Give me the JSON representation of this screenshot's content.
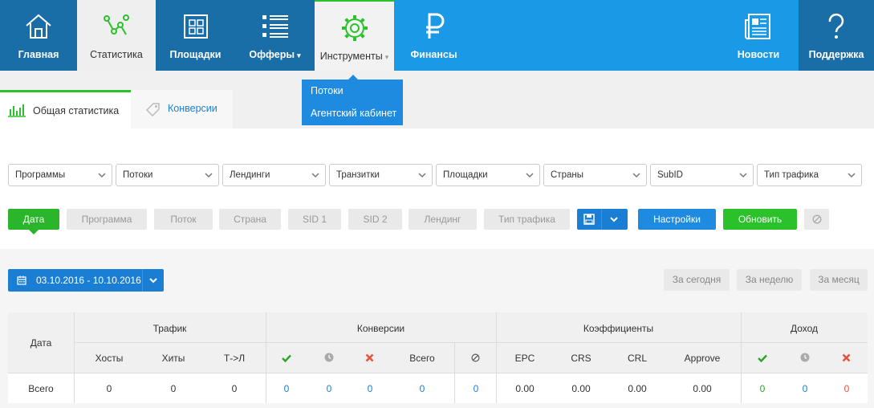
{
  "topnav": {
    "home": "Главная",
    "stats": "Статистика",
    "platforms": "Площадки",
    "offers": "Офферы",
    "tools": "Инструменты",
    "finance": "Финансы",
    "news": "Новости",
    "support": "Поддержка",
    "caret": "▾"
  },
  "tools_menu": [
    "Потоки",
    "Агентский кабинет"
  ],
  "subtabs": {
    "general": "Общая статистика",
    "conversions": "Конверсии"
  },
  "filters": [
    "Программы",
    "Потоки",
    "Лендинги",
    "Транзитки",
    "Площадки",
    "Страны",
    "SubID",
    "Тип трафика"
  ],
  "groupby": [
    "Дата",
    "Программа",
    "Поток",
    "Страна",
    "SID 1",
    "SID 2",
    "Лендинг",
    "Тип трафика"
  ],
  "actions": {
    "settings": "Настройки",
    "refresh": "Обновить"
  },
  "date_range": "03.10.2016 - 10.10.2016",
  "quick_ranges": [
    "За сегодня",
    "За неделю",
    "За месяц"
  ],
  "table": {
    "date_header": "Дата",
    "groups": [
      "Трафик",
      "Конверсии",
      "Коэффициенты",
      "Доход"
    ],
    "traffic_cols": [
      "Хосты",
      "Хиты",
      "Т->Л"
    ],
    "conversions_total_col": "Всего",
    "ratio_cols": [
      "EPC",
      "CRS",
      "CRL",
      "Approve"
    ],
    "total_label": "Всего",
    "traffic_values": [
      "0",
      "0",
      "0"
    ],
    "conversion_values": [
      "0",
      "0",
      "0",
      "0",
      "0"
    ],
    "ratio_values": [
      "0.00",
      "0.00",
      "0.00",
      "0.00"
    ],
    "income_values": [
      "0",
      "0",
      "0"
    ]
  },
  "colors": {
    "accent": "#1a9ae6",
    "dark_nav": "#196ea8",
    "green": "#2bc12b",
    "red": "#e5533c"
  }
}
